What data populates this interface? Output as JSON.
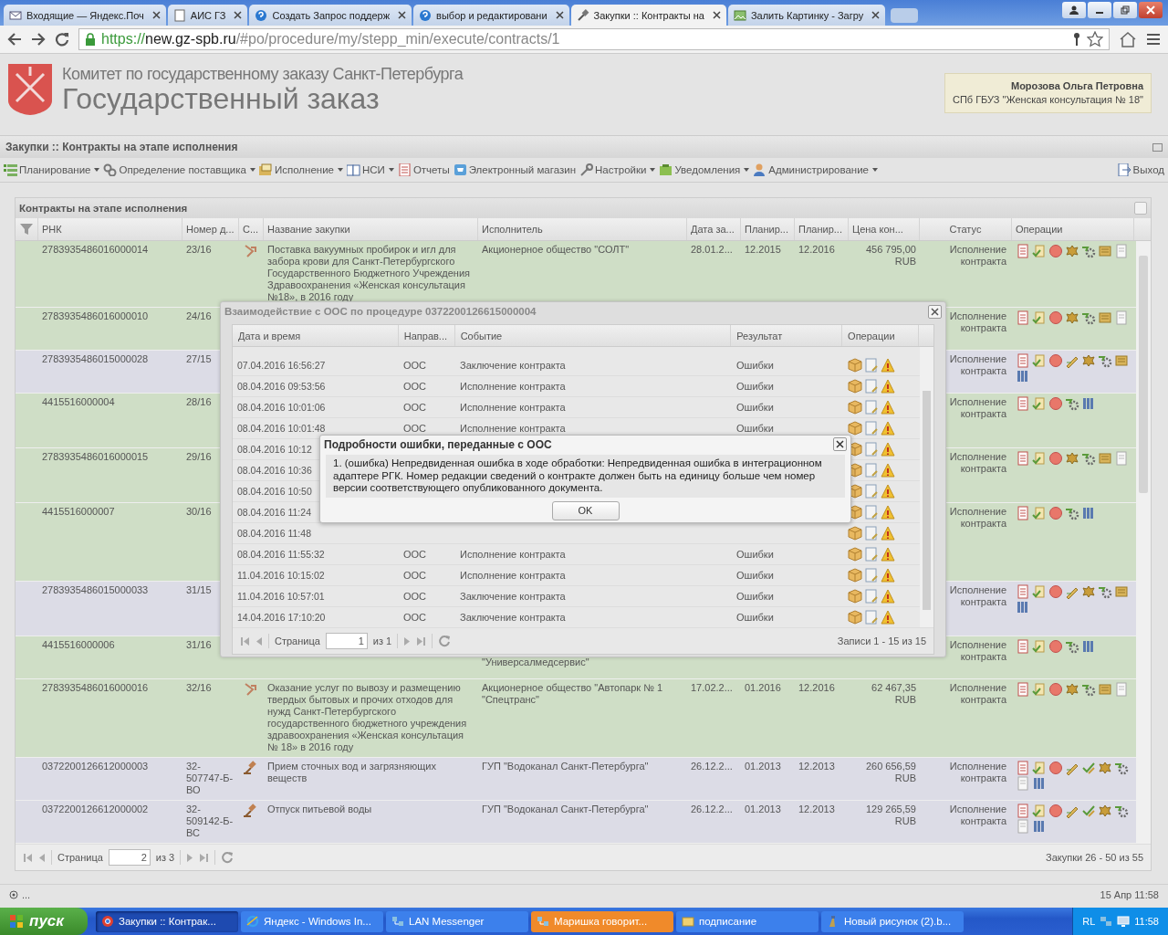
{
  "browser": {
    "tabs": [
      {
        "title": "Входящие — Яндекс.Поч",
        "selected": false
      },
      {
        "title": "АИС ГЗ",
        "selected": false
      },
      {
        "title": "Создать Запрос поддерж",
        "selected": false
      },
      {
        "title": "выбор и редактировани",
        "selected": false
      },
      {
        "title": "Закупки :: Контракты на",
        "selected": true
      },
      {
        "title": "Залить Картинку - Загру",
        "selected": false
      }
    ],
    "url": {
      "scheme": "https://",
      "host": "new.gz-spb.ru",
      "path": "/#po/procedure/my/stepp_min/execute/contracts/1"
    }
  },
  "header": {
    "subtitle": "Комитет по государственному заказу Санкт-Петербурга",
    "title": "Государственный заказ",
    "user": {
      "name": "Морозова Ольга Петровна",
      "org": "СПб ГБУЗ \"Женская консультация № 18\""
    }
  },
  "page_title": "Закупки :: Контракты на этапе исполнения",
  "menu": [
    {
      "label": "Планирование",
      "dropdown": true
    },
    {
      "label": "Определение поставщика",
      "dropdown": true
    },
    {
      "label": "Исполнение",
      "dropdown": true
    },
    {
      "label": "НСИ",
      "dropdown": true
    },
    {
      "label": "Отчеты",
      "dropdown": false
    },
    {
      "label": "Электронный магазин",
      "dropdown": false
    },
    {
      "label": "Настройки",
      "dropdown": true
    },
    {
      "label": "Уведомления",
      "dropdown": true
    },
    {
      "label": "Администрирование",
      "dropdown": true
    }
  ],
  "logout": "Выход",
  "grid": {
    "title": "Контракты на этапе исполнения",
    "columns": [
      "РНК",
      "Номер д...",
      "С...",
      "Название закупки",
      "Исполнитель",
      "Дата за...",
      "Планир...",
      "Планир...",
      "Цена кон...",
      "Статус",
      "Операции"
    ],
    "rows": [
      {
        "rnk": "2783935486016000014",
        "number": "23/16",
        "method_icon": {
          "kind": "arrow"
        },
        "name": "Поставка вакуумных пробирок и игл для забора крови для Санкт-Петербургского Государственного Бюджетного Учреждения Здравоохранения «Женская консультация №18», в 2016 году",
        "executor": "Акционерное общество \"СОЛТ\"",
        "date": "28.01.2...",
        "plan_start": "12.2015",
        "plan_end": "12.2016",
        "price": "456 795,00",
        "currency": "RUB",
        "status": "Исполнение контракта",
        "color": "#cfdec6",
        "ops": [
          {
            "kind": "report"
          },
          {
            "kind": "scroll"
          },
          {
            "kind": "stop"
          },
          {
            "kind": "emblem"
          },
          {
            "kind": "gear"
          },
          {
            "kind": "ledger"
          },
          {
            "kind": "page"
          }
        ]
      },
      {
        "rnk": "2783935486016000010",
        "number": "24/16",
        "status": "Исполнение контракта",
        "color": "#cfdec6",
        "ops": [
          {
            "kind": "report"
          },
          {
            "kind": "scroll"
          },
          {
            "kind": "stop"
          },
          {
            "kind": "emblem"
          },
          {
            "kind": "gear"
          },
          {
            "kind": "ledger"
          },
          {
            "kind": "page"
          }
        ]
      },
      {
        "rnk": "2783935486015000028",
        "number": "27/15",
        "status": "Исполнение контракта",
        "color": "#dcdce6",
        "ops": [
          {
            "kind": "report"
          },
          {
            "kind": "scroll"
          },
          {
            "kind": "stop"
          },
          {
            "kind": "sign"
          },
          {
            "kind": "emblem"
          },
          {
            "kind": "gear"
          },
          {
            "kind": "ledger"
          },
          {
            "kind": "books"
          }
        ]
      },
      {
        "rnk": "4415516000004",
        "number": "28/16",
        "status": "Исполнение контракта",
        "color": "#cfdec6",
        "ops": [
          {
            "kind": "report"
          },
          {
            "kind": "scroll"
          },
          {
            "kind": "stop"
          },
          {
            "kind": "gear"
          },
          {
            "kind": "books"
          }
        ]
      },
      {
        "rnk": "2783935486016000015",
        "number": "29/16",
        "status": "Исполнение контракта",
        "color": "#cfdec6",
        "ops": [
          {
            "kind": "report"
          },
          {
            "kind": "scroll"
          },
          {
            "kind": "stop"
          },
          {
            "kind": "emblem"
          },
          {
            "kind": "gear"
          },
          {
            "kind": "ledger"
          },
          {
            "kind": "page"
          }
        ]
      },
      {
        "rnk": "4415516000007",
        "number": "30/16",
        "status": "Исполнение контракта",
        "color": "#cfdec6",
        "ops": [
          {
            "kind": "report"
          },
          {
            "kind": "scroll"
          },
          {
            "kind": "stop"
          },
          {
            "kind": "gear"
          },
          {
            "kind": "books"
          }
        ]
      },
      {
        "rnk": "2783935486015000033",
        "number": "31/15",
        "status": "Исполнение контракта",
        "color": "#dcdce6",
        "ops": [
          {
            "kind": "report"
          },
          {
            "kind": "scroll"
          },
          {
            "kind": "stop"
          },
          {
            "kind": "sign"
          },
          {
            "kind": "emblem"
          },
          {
            "kind": "gear"
          },
          {
            "kind": "ledger"
          },
          {
            "kind": "books"
          }
        ]
      },
      {
        "rnk": "4415516000006",
        "number": "31/16",
        "executor_tail": "\"Универсалмедсервис\"",
        "status": "Исполнение контракта",
        "color": "#cfdec6",
        "ops": [
          {
            "kind": "report"
          },
          {
            "kind": "scroll"
          },
          {
            "kind": "stop"
          },
          {
            "kind": "gear"
          },
          {
            "kind": "books"
          }
        ]
      },
      {
        "rnk": "2783935486016000016",
        "number": "32/16",
        "method_icon": {
          "kind": "arrow"
        },
        "name": "Оказание услуг по вывозу и размещению твердых бытовых и прочих отходов для нужд Санкт-Петербургского государственного бюджетного учреждения здравоохранения «Женская консультация № 18» в 2016 году",
        "executor": "Акционерное общество \"Автопарк № 1 \"Спецтранс\"",
        "date": "17.02.2...",
        "plan_start": "01.2016",
        "plan_end": "12.2016",
        "price": "62 467,35",
        "currency": "RUB",
        "status": "Исполнение контракта",
        "color": "#cfdec6",
        "ops": [
          {
            "kind": "report"
          },
          {
            "kind": "scroll"
          },
          {
            "kind": "stop"
          },
          {
            "kind": "emblem"
          },
          {
            "kind": "gear"
          },
          {
            "kind": "ledger"
          },
          {
            "kind": "page"
          }
        ]
      },
      {
        "rnk": "0372200126612000003",
        "number": "32-507747-Б-ВО",
        "method_icon": {
          "kind": "gavel"
        },
        "name": "Прием сточных вод и загрязняющих веществ",
        "executor": "ГУП \"Водоканал Санкт-Петербурга\"",
        "date": "26.12.2...",
        "plan_start": "01.2013",
        "plan_end": "12.2013",
        "price": "260 656,59",
        "currency": "RUB",
        "status": "Исполнение контракта",
        "color": "#dcdce6",
        "ops": [
          {
            "kind": "report"
          },
          {
            "kind": "scroll"
          },
          {
            "kind": "stop"
          },
          {
            "kind": "sign"
          },
          {
            "kind": "check"
          },
          {
            "kind": "emblem"
          },
          {
            "kind": "gear"
          },
          {
            "kind": "page"
          },
          {
            "kind": "books"
          }
        ]
      },
      {
        "rnk": "0372200126612000002",
        "number": "32-509142-Б-ВС",
        "method_icon": {
          "kind": "gavel"
        },
        "name": "Отпуск питьевой воды",
        "executor": "ГУП \"Водоканал Санкт-Петербурга\"",
        "date": "26.12.2...",
        "plan_start": "01.2013",
        "plan_end": "12.2013",
        "price": "129 265,59",
        "currency": "RUB",
        "status": "Исполнение контракта",
        "color": "#dcdce6",
        "ops": [
          {
            "kind": "report"
          },
          {
            "kind": "scroll"
          },
          {
            "kind": "stop"
          },
          {
            "kind": "sign"
          },
          {
            "kind": "check"
          },
          {
            "kind": "emblem"
          },
          {
            "kind": "gear"
          },
          {
            "kind": "page"
          },
          {
            "kind": "books"
          }
        ]
      }
    ],
    "pager": {
      "page_label": "Страница",
      "page": "2",
      "of": "из 3",
      "summary": "Закупки 26 - 50 из 55"
    }
  },
  "oos_dialog": {
    "title": "Взаимодействие с ООС по процедуре 0372200126615000004",
    "columns": [
      "Дата и время",
      "Направ...",
      "Событие",
      "Результат",
      "Операции"
    ],
    "rows": [
      {
        "time": "07.04.2016 16:56:27",
        "direction": "ООС",
        "event": "Заключение контракта",
        "result": "Ошибки"
      },
      {
        "time": "08.04.2016 09:53:56",
        "direction": "ООС",
        "event": "Исполнение контракта",
        "result": "Ошибки"
      },
      {
        "time": "08.04.2016 10:01:06",
        "direction": "ООС",
        "event": "Исполнение контракта",
        "result": "Ошибки"
      },
      {
        "time": "08.04.2016 10:01:48",
        "direction": "ООС",
        "event": "Исполнение контракта",
        "result": "Ошибки"
      },
      {
        "time": "08.04.2016 10:12"
      },
      {
        "time": "08.04.2016 10:36"
      },
      {
        "time": "08.04.2016 10:50"
      },
      {
        "time": "08.04.2016 11:24"
      },
      {
        "time": "08.04.2016 11:48"
      },
      {
        "time": "08.04.2016 11:55:32",
        "direction": "ООС",
        "event": "Исполнение контракта",
        "result": "Ошибки"
      },
      {
        "time": "11.04.2016 10:15:02",
        "direction": "ООС",
        "event": "Исполнение контракта",
        "result": "Ошибки"
      },
      {
        "time": "11.04.2016 10:57:01",
        "direction": "ООС",
        "event": "Заключение контракта",
        "result": "Ошибки"
      },
      {
        "time": "14.04.2016 17:10:20",
        "direction": "ООС",
        "event": "Заключение контракта",
        "result": "Ошибки"
      }
    ],
    "pager": {
      "page_label": "Страница",
      "page": "1",
      "of": "из 1",
      "summary": "Записи 1 - 15 из 15"
    }
  },
  "error_dialog": {
    "title": "Подробности ошибки, переданные с ООС",
    "message": "1. (ошибка) Непредвиденная ошибка в ходе обработки: Непредвиденная ошибка в интеграционном адаптере РГК. Номер редакции сведений о контракте должен быть на единицу больше чем номер версии соответствующего опубликованного документа.",
    "button": "OK"
  },
  "status_bar": {
    "left": "...",
    "right": "15 Апр 11:58"
  },
  "taskbar": {
    "start": "пуск",
    "items": [
      {
        "label": "Закупки :: Контрак...",
        "selected": true,
        "flashing": false
      },
      {
        "label": "Яндекс - Windows In...",
        "selected": false,
        "flashing": false
      },
      {
        "label": "LAN Messenger",
        "selected": false,
        "flashing": false
      },
      {
        "label": "Маришка говорит...",
        "selected": false,
        "flashing": true
      },
      {
        "label": "подписание",
        "selected": false,
        "flashing": false
      },
      {
        "label": "Новый рисунок (2).b...",
        "selected": false,
        "flashing": false
      }
    ],
    "lang": "RL",
    "clock": "11:58"
  }
}
